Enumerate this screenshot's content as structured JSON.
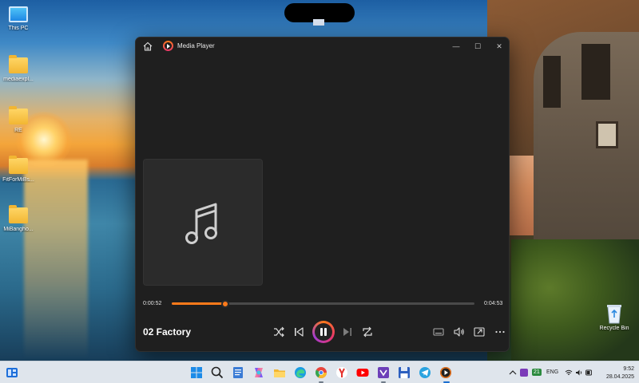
{
  "desktop": {
    "icons": [
      {
        "label": "This PC",
        "kind": "pc"
      },
      {
        "label": "mediaexpl...",
        "kind": "folder"
      },
      {
        "label": "RE",
        "kind": "folder"
      },
      {
        "label": "FitForMiBs...",
        "kind": "folder"
      },
      {
        "label": "MiBangho...",
        "kind": "folder"
      }
    ],
    "recycle_bin_label": "Recycle Bin"
  },
  "window": {
    "title": "Media Player",
    "home_icon": "home-icon",
    "controls": {
      "minimize": "—",
      "maximize": "☐",
      "close": "✕"
    }
  },
  "player": {
    "elapsed": "0:00:52",
    "total": "0:04:53",
    "progress_fraction": 0.177,
    "track_title": "02 Factory",
    "accent_color": "#ff7a1a",
    "album_art_icon": "music-note-icon",
    "buttons": [
      "shuffle-icon",
      "previous-icon",
      "pause-icon",
      "next-icon",
      "repeat-icon",
      "miniplayer-icon",
      "volume-icon",
      "cast-icon",
      "more-icon"
    ]
  },
  "taskbar": {
    "language": "ENG",
    "time": "9:52",
    "date": "28.04.2025",
    "badge_count": "21",
    "apps": [
      "start-icon",
      "search-icon",
      "notepad-icon",
      "copilot-icon",
      "file-explorer-icon",
      "edge-icon",
      "chrome-icon",
      "yandex-icon",
      "youtube-icon",
      "visual-studio-icon",
      "floppy-icon",
      "telegram-icon",
      "media-player-icon"
    ]
  }
}
